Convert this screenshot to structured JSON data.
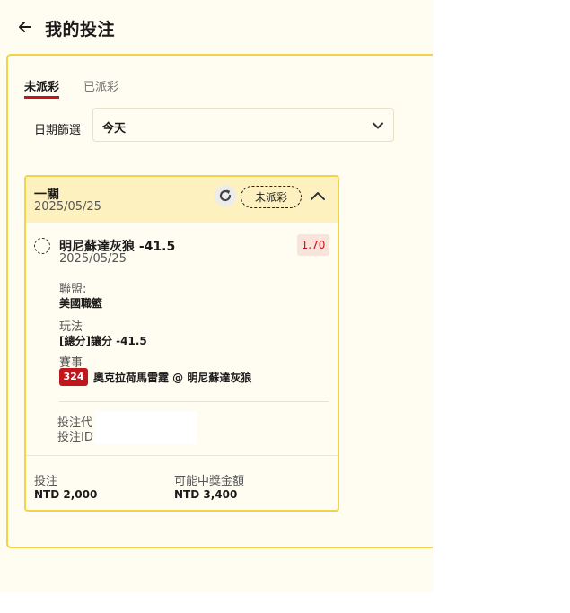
{
  "header": {
    "title": "我的投注",
    "back_icon": "arrow-left-icon"
  },
  "tabs": [
    {
      "label": "未派彩",
      "active": true
    },
    {
      "label": "已派彩",
      "active": false
    }
  ],
  "filter": {
    "label": "日期篩選",
    "value": "今天"
  },
  "bet": {
    "type": "一關",
    "date": "2025/05/25",
    "status": "未派彩",
    "selection": {
      "title": "明尼蘇達灰狼 -41.5",
      "date": "2025/05/25",
      "odds": "1.70",
      "league_label": "聯盟:",
      "league": "美國職籃",
      "market_label": "玩法",
      "market": "[總分]讓分 -41.5",
      "event_label": "賽事",
      "event_id": "324",
      "event_name": "奧克拉荷馬雷霆 @ 明尼蘇達灰狼"
    },
    "meta": {
      "code_label": "投注代",
      "id_label": "投注ID"
    },
    "stake_label": "投注",
    "stake_value": "NTD 2,000",
    "payout_label": "可能中獎金額",
    "payout_value": "NTD 3,400"
  },
  "colors": {
    "accent_red": "#c0171d",
    "border_yellow": "#f2d34a",
    "panel_bg": "#fffcf1",
    "card_head_bg": "#fdf1c0"
  }
}
